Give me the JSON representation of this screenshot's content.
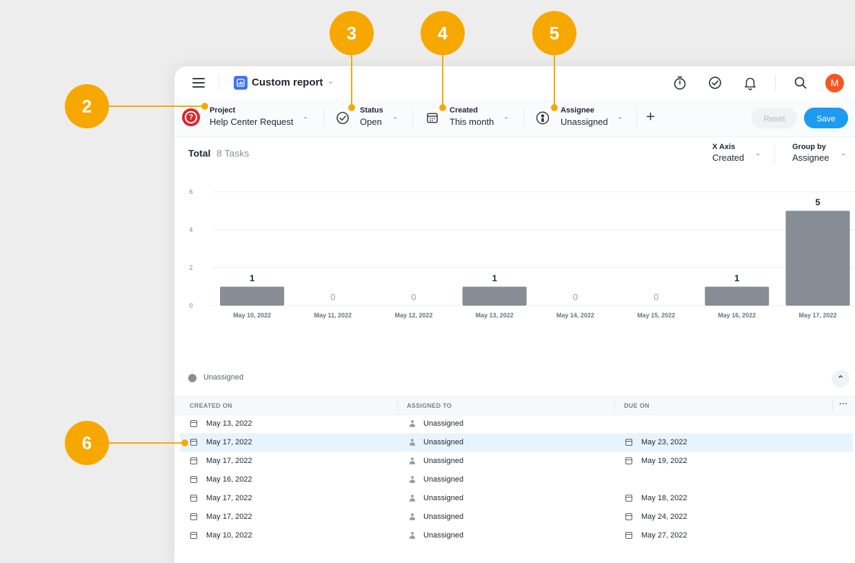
{
  "header": {
    "title": "Custom report"
  },
  "filters": {
    "project": {
      "label": "Project",
      "value": "Help Center Request"
    },
    "status": {
      "label": "Status",
      "value": "Open"
    },
    "created": {
      "label": "Created",
      "value": "This month"
    },
    "assignee": {
      "label": "Assignee",
      "value": "Unassigned"
    },
    "add_icon": "plus-icon",
    "reset_label": "Reset",
    "save_label": "Save"
  },
  "summary": {
    "total_label": "Total",
    "total_count": "8 Tasks",
    "x_axis": {
      "label": "X Axis",
      "value": "Created"
    },
    "group_by": {
      "label": "Group by",
      "value": "Assignee"
    }
  },
  "chart_data": {
    "type": "bar",
    "categories": [
      "May 10, 2022",
      "May 11, 2022",
      "May 12, 2022",
      "May 13, 2022",
      "May 14, 2022",
      "May 15, 2022",
      "May 16, 2022",
      "May 17, 2022"
    ],
    "series": [
      {
        "name": "Unassigned",
        "values": [
          1,
          0,
          0,
          1,
          0,
          0,
          1,
          5
        ]
      }
    ],
    "yticks": [
      0,
      2,
      4,
      6,
      8
    ],
    "ylim": [
      0,
      8
    ],
    "grid": true,
    "legend": "bottom-left",
    "bar_color": "#878d94"
  },
  "legend": {
    "label": "Unassigned"
  },
  "table": {
    "columns": [
      "CREATED ON",
      "ASSIGNED TO",
      "DUE ON"
    ],
    "more_label": "···",
    "rows": [
      {
        "created": "May 13, 2022",
        "assigned": "Unassigned",
        "due": ""
      },
      {
        "created": "May 17, 2022",
        "assigned": "Unassigned",
        "due": "May 23, 2022"
      },
      {
        "created": "May 17, 2022",
        "assigned": "Unassigned",
        "due": "May 19, 2022"
      },
      {
        "created": "May 16, 2022",
        "assigned": "Unassigned",
        "due": ""
      },
      {
        "created": "May 17, 2022",
        "assigned": "Unassigned",
        "due": "May 18, 2022"
      },
      {
        "created": "May 17, 2022",
        "assigned": "Unassigned",
        "due": "May 24, 2022"
      },
      {
        "created": "May 10, 2022",
        "assigned": "Unassigned",
        "due": "May 27, 2022"
      }
    ],
    "highlighted_row": 1
  },
  "callouts": [
    "2",
    "3",
    "4",
    "5",
    "6"
  ],
  "colors": {
    "accent": "#1e9bf0",
    "callout": "#f6a800",
    "project_icon": "#e0232c",
    "avatar": "#f25722"
  },
  "user": {
    "initial": "M"
  }
}
